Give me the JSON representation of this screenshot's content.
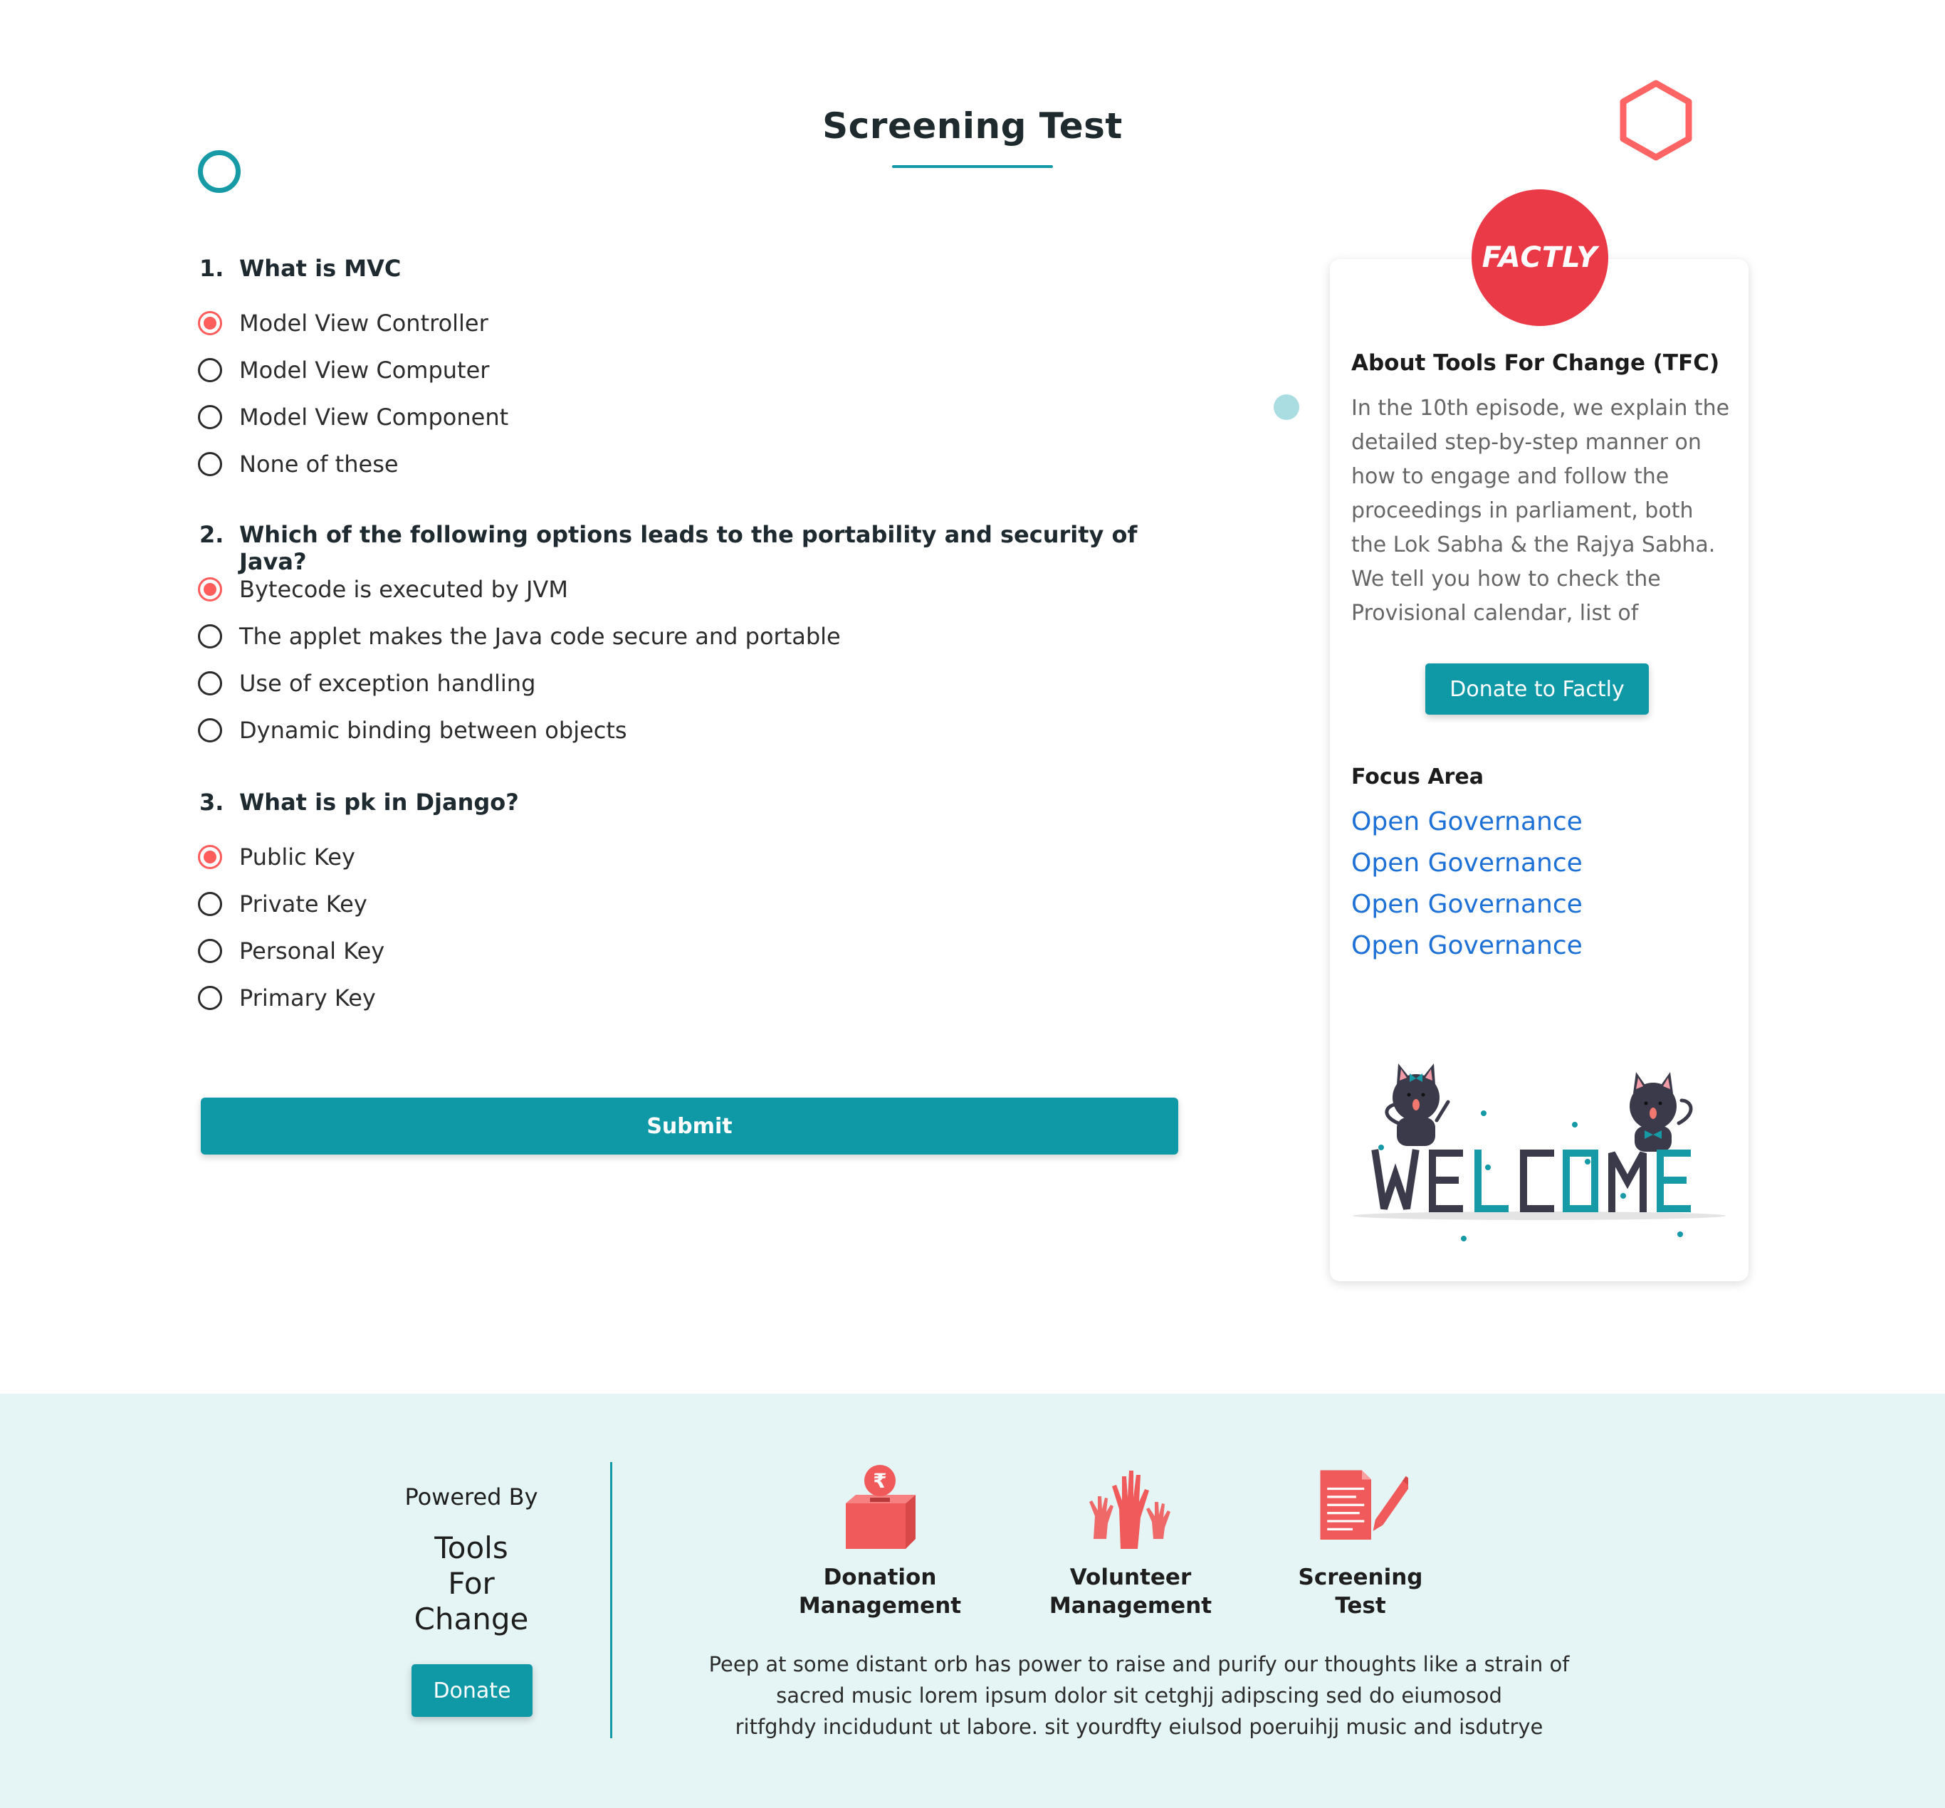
{
  "page": {
    "title": "Screening Test"
  },
  "questions": [
    {
      "number": "1.",
      "text": "What is MVC",
      "options": [
        {
          "label": "Model View Controller",
          "selected": true
        },
        {
          "label": "Model View Computer",
          "selected": false
        },
        {
          "label": "Model View Component",
          "selected": false
        },
        {
          "label": "None of these",
          "selected": false
        }
      ]
    },
    {
      "number": "2.",
      "text": "Which of the following options leads to the portability and security of Java?",
      "options": [
        {
          "label": "Bytecode is executed by JVM",
          "selected": true
        },
        {
          "label": "The applet makes the Java code secure and portable",
          "selected": false
        },
        {
          "label": "Use of exception handling",
          "selected": false
        },
        {
          "label": "Dynamic binding between objects",
          "selected": false
        }
      ]
    },
    {
      "number": "3.",
      "text": "What is pk in Django?",
      "options": [
        {
          "label": "Public Key",
          "selected": true
        },
        {
          "label": "Private Key",
          "selected": false
        },
        {
          "label": "Personal Key",
          "selected": false
        },
        {
          "label": "Primary Key",
          "selected": false
        }
      ]
    }
  ],
  "submit_label": "Submit",
  "sidebar": {
    "logo_text": "FACTLY",
    "about_title": "About Tools For Change (TFC)",
    "about_text": "In the 10th episode, we explain the\ndetailed step-by-step manner on\nhow to engage and follow the\nproceedings in parliament, both\nthe Lok Sabha & the Rajya Sabha.\nWe tell you how to check the\nProvisional calendar, list of",
    "donate_label": "Donate to Factly",
    "focus_title": "Focus Area",
    "focus_links": [
      "Open Governance",
      "Open Governance",
      "Open Governance",
      "Open Governance"
    ],
    "welcome_text": "WELCOME"
  },
  "footer": {
    "powered_by": "Powered By",
    "org_name": "Tools\nFor\nChange",
    "donate_label": "Donate",
    "features": [
      {
        "label": "Donation\nManagement",
        "icon": "donation-box-icon"
      },
      {
        "label": "Volunteer\nManagement",
        "icon": "raised-hands-icon"
      },
      {
        "label": "Screening\nTest",
        "icon": "document-pencil-icon"
      }
    ],
    "description": "Peep at some distant orb has power to raise and purify our thoughts like a strain of\nsacred music lorem ipsum dolor sit  cetghjj adipscing sed do eiumosod\nritfghdy incidudunt ut labore. sit yourdfty eiulsod poeruihjj  music and isdutrye"
  },
  "colors": {
    "accent": "#0f99a6",
    "radio_selected": "#ff5c5c",
    "logo_bg": "#ea3a48",
    "icon_red": "#f05a5a",
    "link": "#1d70d6",
    "footer_bg": "#e5f4f5"
  }
}
